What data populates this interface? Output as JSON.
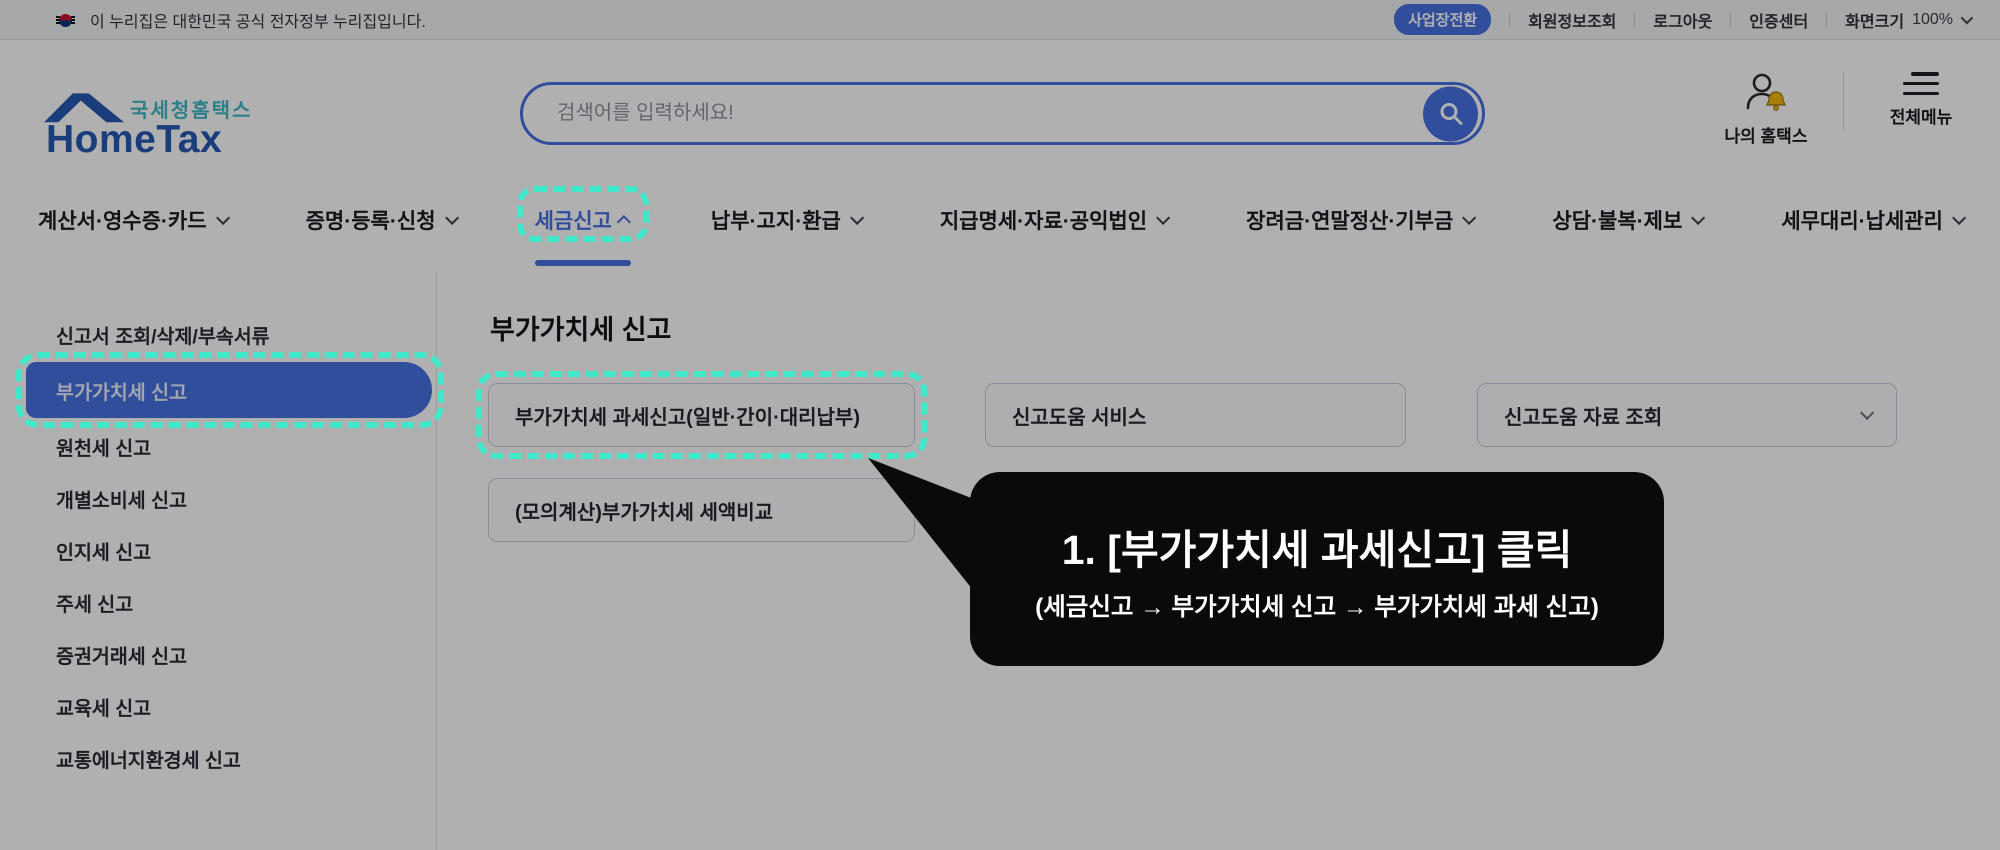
{
  "utility_bar": {
    "official_notice": "이 누리집은 대한민국 공식 전자정부 누리집입니다.",
    "workplace_switch_label": "사업장전환",
    "links": [
      {
        "label": "회원정보조회"
      },
      {
        "label": "로그아웃"
      },
      {
        "label": "인증센터"
      }
    ],
    "screen_size_label": "화면크기",
    "screen_size_value": "100%"
  },
  "header": {
    "logo_subtitle": "국세청홈택스",
    "logo_title": "HomeTax",
    "search_placeholder": "검색어를 입력하세요!",
    "my_hometax_label": "나의 홈택스",
    "full_menu_label": "전체메뉴"
  },
  "nav": {
    "items": [
      {
        "label": "계산서·영수증·카드",
        "state": "collapsed"
      },
      {
        "label": "증명·등록·신청",
        "state": "collapsed"
      },
      {
        "label": "세금신고",
        "state": "expanded",
        "active": true,
        "highlighted": true
      },
      {
        "label": "납부·고지·환급",
        "state": "collapsed"
      },
      {
        "label": "지급명세·자료·공익법인",
        "state": "collapsed"
      },
      {
        "label": "장려금·연말정산·기부금",
        "state": "collapsed"
      },
      {
        "label": "상담·불복·제보",
        "state": "collapsed"
      },
      {
        "label": "세무대리·납세관리",
        "state": "collapsed"
      }
    ]
  },
  "sidebar": {
    "items": [
      {
        "label": "신고서 조회/삭제/부속서류"
      },
      {
        "label": "부가가치세 신고",
        "selected": true,
        "highlighted": true
      },
      {
        "label": "원천세 신고"
      },
      {
        "label": "개별소비세 신고"
      },
      {
        "label": "인지세 신고"
      },
      {
        "label": "주세 신고"
      },
      {
        "label": "증권거래세 신고"
      },
      {
        "label": "교육세 신고"
      },
      {
        "label": "교통에너지환경세 신고"
      }
    ]
  },
  "main": {
    "title": "부가가치세 신고",
    "cards": [
      {
        "label": "부가가치세 과세신고(일반·간이·대리납부)",
        "highlighted": true
      },
      {
        "label": "신고도움 서비스"
      },
      {
        "label": "신고도움 자료 조회",
        "has_dropdown": true
      },
      {
        "label": "(모의계산)부가가치세 세액비교"
      }
    ]
  },
  "callout": {
    "line1": "1. [부가가치세 과세신고] 클릭",
    "line2": "(세금신고 → 부가가치세 신고 → 부가가치세 과세 신고)"
  },
  "colors": {
    "accent_blue": "#456fe0",
    "highlight_teal": "#3fe9c9",
    "bell_yellow": "#f0b60a",
    "callout_bg": "#0a0a0b"
  }
}
